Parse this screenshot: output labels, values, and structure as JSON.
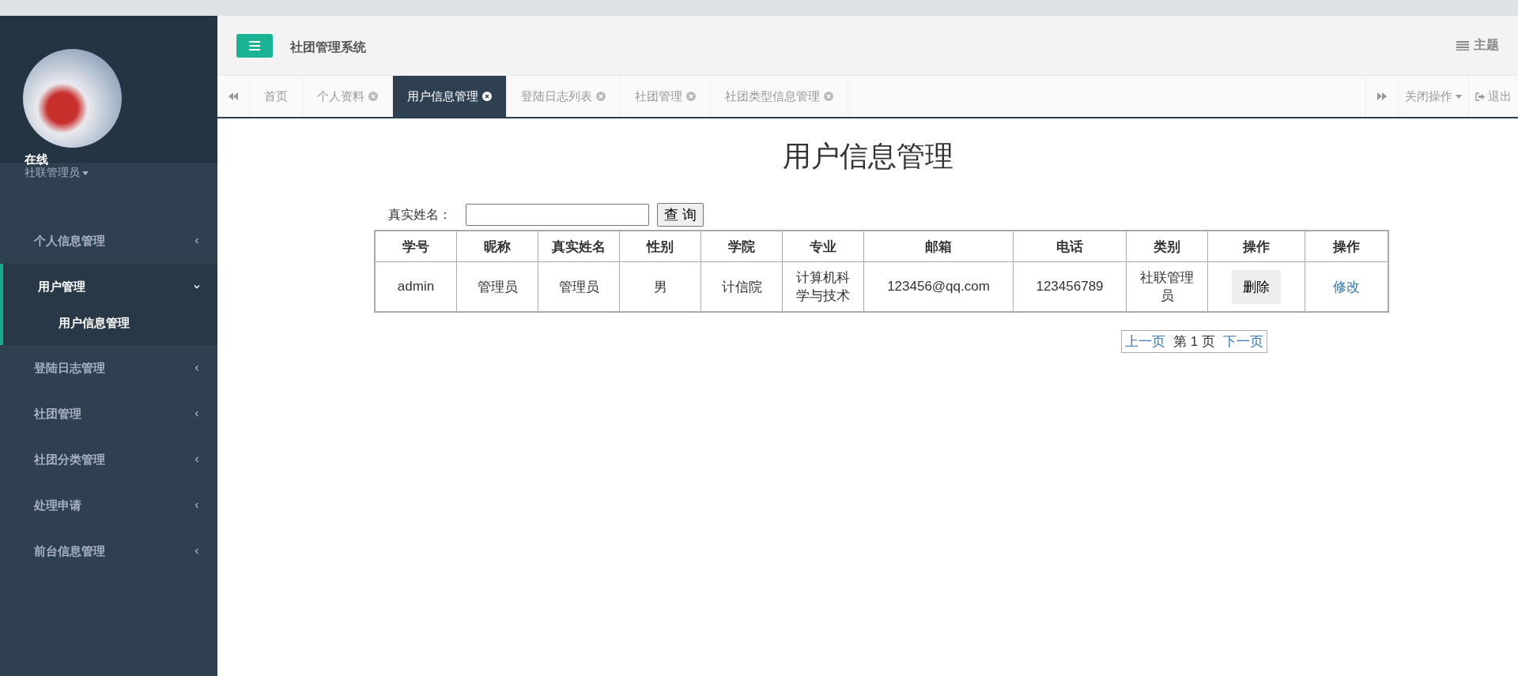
{
  "header": {
    "title": "社团管理系统",
    "theme": "主题"
  },
  "sidebar": {
    "status": "在线",
    "role": "社联管理员",
    "items": [
      {
        "label": "个人信息管理",
        "expanded": false,
        "selected": false
      },
      {
        "label": "用户管理",
        "expanded": true,
        "selected": true,
        "children": [
          {
            "label": "用户信息管理",
            "selected": true
          }
        ]
      },
      {
        "label": "登陆日志管理",
        "expanded": false,
        "selected": false
      },
      {
        "label": "社团管理",
        "expanded": false,
        "selected": false
      },
      {
        "label": "社团分类管理",
        "expanded": false,
        "selected": false
      },
      {
        "label": "处理申请",
        "expanded": false,
        "selected": false
      },
      {
        "label": "前台信息管理",
        "expanded": false,
        "selected": false
      }
    ]
  },
  "tabs": [
    {
      "label": "首页",
      "selected": false,
      "closable": false
    },
    {
      "label": "个人资料",
      "selected": false,
      "closable": true
    },
    {
      "label": "用户信息管理",
      "selected": true,
      "closable": true
    },
    {
      "label": "登陆日志列表",
      "selected": false,
      "closable": true
    },
    {
      "label": "社团管理",
      "selected": false,
      "closable": true
    },
    {
      "label": "社团类型信息管理",
      "selected": false,
      "closable": true
    }
  ],
  "tab_actions": {
    "close_menu": "关闭操作",
    "logout": "退出"
  },
  "page": {
    "title": "用户信息管理",
    "search_label": "真实姓名：",
    "search_button": "查 询",
    "table": {
      "columns": [
        "学号",
        "昵称",
        "真实姓名",
        "性别",
        "学院",
        "专业",
        "邮箱",
        "电话",
        "类别",
        "操作",
        "操作"
      ],
      "rows": [
        [
          {
            "kind": "text",
            "text": "admin"
          },
          {
            "kind": "text",
            "text": "管理员"
          },
          {
            "kind": "text",
            "text": "管理员"
          },
          {
            "kind": "text",
            "text": "男"
          },
          {
            "kind": "text",
            "text": "计信院"
          },
          {
            "kind": "text",
            "text": "计算机科学与技术"
          },
          {
            "kind": "text",
            "text": "123456@qq.com"
          },
          {
            "kind": "text",
            "text": "123456789"
          },
          {
            "kind": "text",
            "text": "社联管理员"
          },
          {
            "kind": "button",
            "text": "删除"
          },
          {
            "kind": "link",
            "text": "修改"
          }
        ]
      ]
    },
    "pagination": {
      "prev": "上一页",
      "current": "第 1 页",
      "next": "下一页"
    }
  }
}
